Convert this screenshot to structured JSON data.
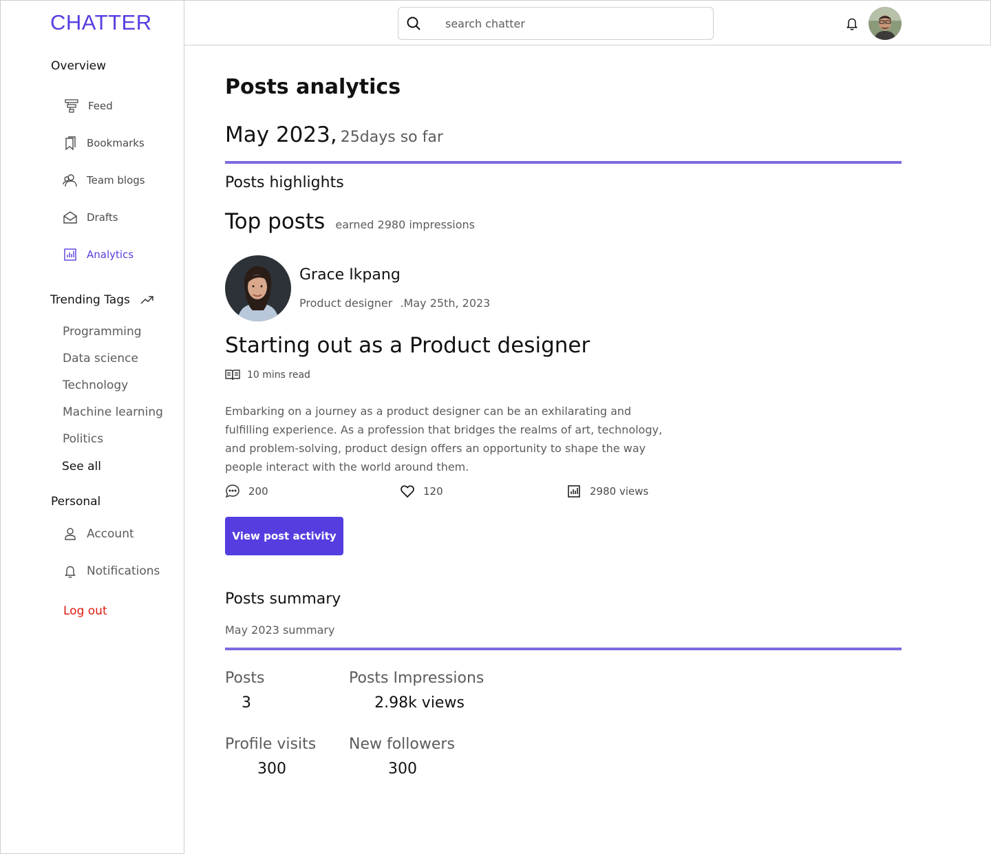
{
  "brand": {
    "logo": "CHATTER",
    "accent": "#543ee0",
    "danger": "#e0190f"
  },
  "sidebar": {
    "overview_title": "Overview",
    "nav": [
      {
        "label": "Feed",
        "icon": "feed-icon"
      },
      {
        "label": "Bookmarks",
        "icon": "bookmark-icon"
      },
      {
        "label": "Team blogs",
        "icon": "team-icon"
      },
      {
        "label": "Drafts",
        "icon": "drafts-icon"
      },
      {
        "label": "Analytics",
        "icon": "analytics-icon",
        "active": true
      }
    ],
    "trending_title": "Trending Tags",
    "tags": [
      "Programming",
      "Data science",
      "Technology",
      "Machine learning",
      "Politics"
    ],
    "see_all": "See all",
    "personal_title": "Personal",
    "personal": [
      {
        "label": "Account",
        "icon": "user-icon"
      },
      {
        "label": "Notifications",
        "icon": "bell-icon"
      }
    ],
    "logout": "Log out"
  },
  "header": {
    "search_placeholder": "search chatter"
  },
  "main": {
    "title": "Posts analytics",
    "period_month": "May 2023,",
    "period_sofar": "25days so far",
    "highlights_title": "Posts highlights",
    "top_posts_title": "Top posts",
    "top_posts_earned": "earned 2980 impressions",
    "post": {
      "author": "Grace Ikpang",
      "role": "Product designer",
      "date": ".May 25th, 2023",
      "title": "Starting out as a Product designer",
      "read_time": "10 mins read",
      "excerpt": "Embarking on a journey as a product designer can be an exhilarating and fulfilling experience. As a profession that bridges the realms of art, technology, and problem-solving, product design offers an opportunity to shape the way people interact with the world around them.",
      "comments": "200",
      "likes": "120",
      "views": "2980 views"
    },
    "cta": "View post activity",
    "summary_title": "Posts summary",
    "summary_sub": "May 2023 summary",
    "metrics": [
      {
        "label": "Posts",
        "value": "3"
      },
      {
        "label": "Posts Impressions",
        "value": "2.98k views"
      },
      {
        "label": "Profile visits",
        "value": "300"
      },
      {
        "label": "New followers",
        "value": "300"
      }
    ]
  }
}
